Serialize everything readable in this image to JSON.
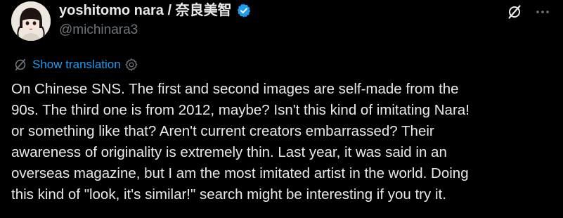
{
  "author": {
    "display_name": "yoshitomo nara / 奈良美智",
    "handle": "@michinara3",
    "verified": true
  },
  "header_icons": [
    {
      "icon": "grok-slash-icon"
    },
    {
      "icon": "more-icon"
    }
  ],
  "translation": {
    "link_label": "Show translation",
    "globe_icon": "translate-globe-icon",
    "settings_icon": "gear-icon"
  },
  "tweet": {
    "text": "On Chinese SNS. The first and second images are self-made from the\n90s. The third one is from 2012, maybe? Isn't this kind of imitating Nara!\nor something like that? Aren't current creators embarrassed? Their\nawareness of originality is extremely thin. Last year, it was said in an\noverseas magazine, but I am the most imitated artist in the world. Doing\nthis kind of \"look, it's similar!\" search might be interesting if you try it."
  },
  "colors": {
    "background": "#000000",
    "primary_text": "#e7e9ea",
    "secondary_text": "#71767b",
    "accent": "#1d9bf0"
  }
}
